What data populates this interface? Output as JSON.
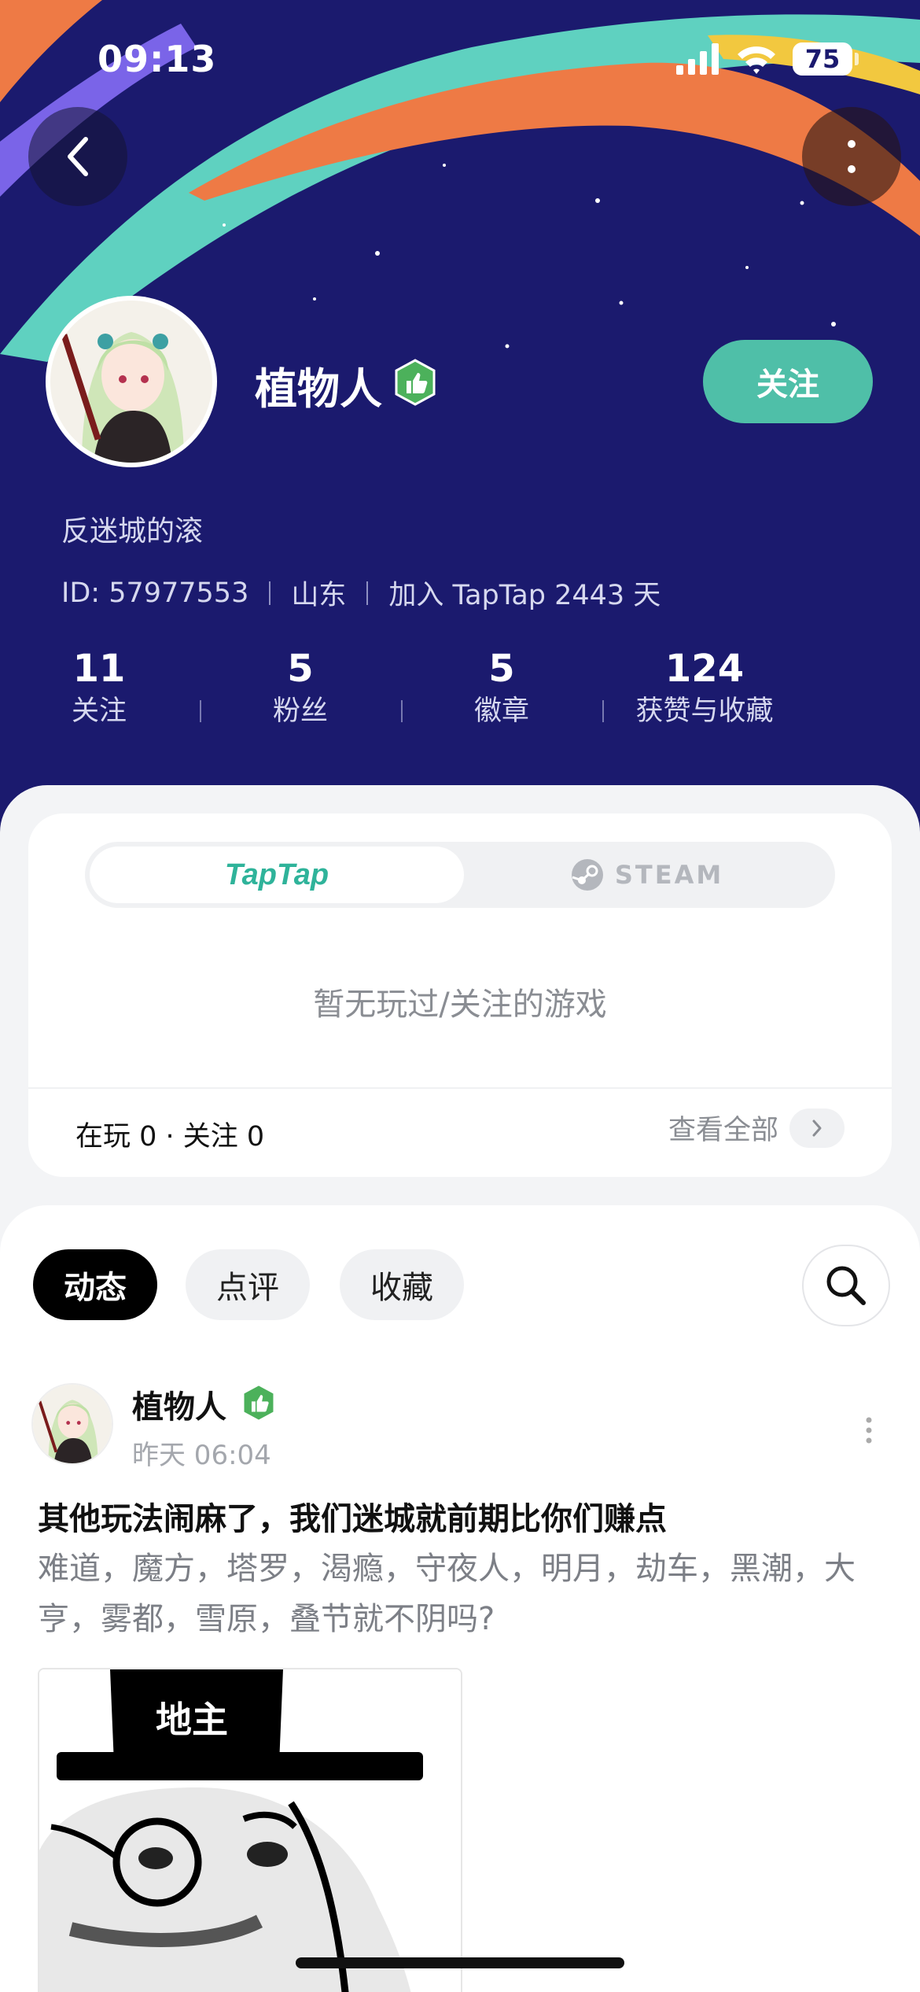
{
  "status_bar": {
    "time": "09:13",
    "battery": "75"
  },
  "profile": {
    "name": "植物人",
    "follow_label": "关注",
    "bio": "反迷城的滚",
    "id_text": "ID: 57977553",
    "region": "山东",
    "joined": "加入 TapTap 2443 天",
    "stats": [
      {
        "value": "11",
        "label": "关注"
      },
      {
        "value": "5",
        "label": "粉丝"
      },
      {
        "value": "5",
        "label": "徽章"
      },
      {
        "value": "124",
        "label": "获赞与收藏"
      }
    ]
  },
  "games": {
    "platforms": [
      "TapTap",
      "STEAM"
    ],
    "selected_platform": "TapTap",
    "empty_text": "暂无玩过/关注的游戏",
    "summary": "在玩 0 · 关注 0",
    "view_all": "查看全部"
  },
  "feed": {
    "tabs": [
      "动态",
      "点评",
      "收藏"
    ],
    "active_tab": "动态",
    "post": {
      "author": "植物人",
      "time": "昨天 06:04",
      "title": "其他玩法闹麻了，我们迷城就前期比你们赚点",
      "body": "难道，魔方，塔罗，渴瘾，守夜人，明月，劫车，黑潮，大亨，雾都，雪原，叠节就不阴吗?",
      "image_caption": "地主"
    }
  },
  "icons": {
    "back": "chevron-left-icon",
    "more": "more-vertical-icon",
    "verified": "thumbs-up-badge-icon",
    "search": "search-icon",
    "steam": "steam-logo-icon",
    "chevron": "chevron-right-icon"
  },
  "colors": {
    "hero_bg": "#1b1a6e",
    "accent": "#4fbfa8",
    "badge_green": "#4cb15b"
  }
}
